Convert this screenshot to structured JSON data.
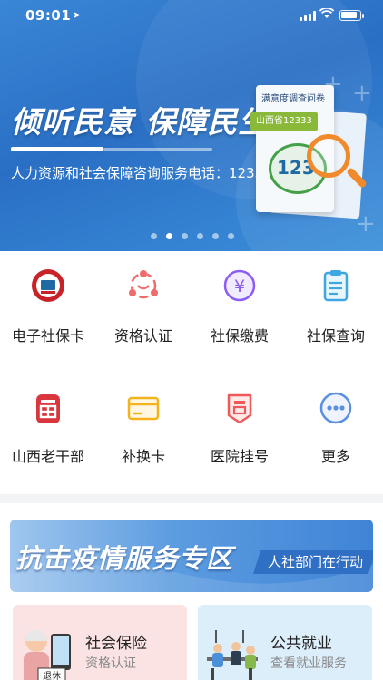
{
  "status_bar": {
    "time": "09:01",
    "location_icon": "location-arrow-icon",
    "wifi_icon": "wifi-icon",
    "battery_icon": "battery-icon"
  },
  "banner": {
    "headline": "倾听民意 保障民生",
    "subline": "人力资源和社会保障咨询服务电话：12333",
    "card_title": "满意度调查问卷",
    "card_tag": "山西省12333",
    "card_logo_text": "123",
    "carousel_pages": 6,
    "carousel_active_index": 1
  },
  "grid": {
    "items": [
      {
        "label": "电子社保卡",
        "icon": "social-security-card-icon",
        "color": "#c9232a"
      },
      {
        "label": "资格认证",
        "icon": "qualification-auth-icon",
        "color": "#f06b6b"
      },
      {
        "label": "社保缴费",
        "icon": "yuan-payment-icon",
        "color": "#8b5cf6"
      },
      {
        "label": "社保查询",
        "icon": "clipboard-query-icon",
        "color": "#3ea6e0"
      },
      {
        "label": "山西老干部",
        "icon": "shanxi-veteran-cadre-icon",
        "color": "#d9363e"
      },
      {
        "label": "补换卡",
        "icon": "card-replace-icon",
        "color": "#f4b21f"
      },
      {
        "label": "医院挂号",
        "icon": "hospital-register-icon",
        "color": "#ee5a5a"
      },
      {
        "label": "更多",
        "icon": "more-dots-icon",
        "color": "#5b8fe0"
      }
    ]
  },
  "promo": {
    "title": "抗击疫情服务专区",
    "tag": "人社部门在行动"
  },
  "services": [
    {
      "name": "社会保险",
      "sub": "资格认证",
      "icon": "retiree-illustration-icon",
      "badge": "退休"
    },
    {
      "name": "公共就业",
      "sub": "查看就业服务",
      "icon": "office-workers-illustration-icon"
    }
  ]
}
